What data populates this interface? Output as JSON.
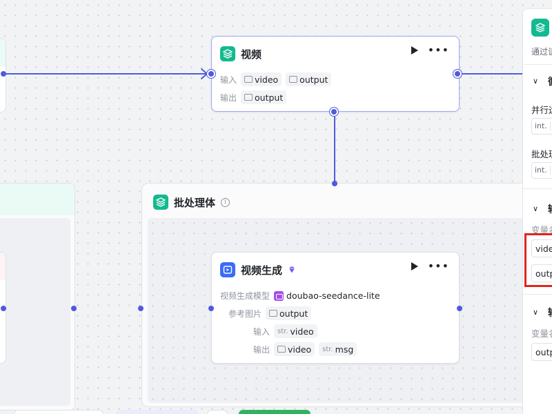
{
  "canvas": {
    "accent": "#4e5bdc",
    "node_icon_color": "#13b98f",
    "highlight_color": "#e1251b"
  },
  "video_node": {
    "title": "视频",
    "input_label": "输入",
    "output_label": "输出",
    "inputs": [
      {
        "icon": "video-type-icon",
        "name": "video"
      },
      {
        "icon": "video-type-icon",
        "name": "output"
      }
    ],
    "outputs": [
      {
        "icon": "video-type-icon",
        "name": "output"
      }
    ]
  },
  "batch_group": {
    "title": "批处理体"
  },
  "gen_node": {
    "title": "视频生成",
    "model_label": "视频生成模型",
    "model_value": "doubao-seedance-lite",
    "ref_label": "参考图片",
    "ref_value": "output",
    "input_label": "输入",
    "input_type": "str.",
    "input_value": "video",
    "output_label": "输出",
    "outputs": [
      {
        "type": "folder",
        "name": "video"
      },
      {
        "type": "str.",
        "name": "msg"
      }
    ]
  },
  "panel": {
    "description": "通过该",
    "section1_title": "循",
    "parallel_label": "并行运",
    "parallel_type": "int.",
    "batch_label": "批处理",
    "batch_type": "int.",
    "section2_title": "输",
    "var_label_1": "变量名",
    "var_1": "vide",
    "var_2": "outp",
    "section3_title": "输",
    "var_label_2": "变量名",
    "var_3": "outp"
  }
}
